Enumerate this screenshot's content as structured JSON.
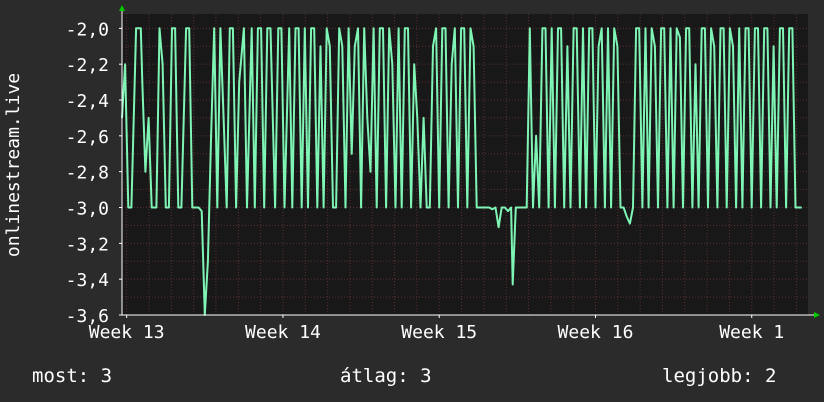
{
  "colors": {
    "background": "#2b2b2b",
    "plot_background": "#181818",
    "grid": "#5a3030",
    "line": "#7ff5b5",
    "axis_arrow": "#00cc00",
    "text": "#ffffff"
  },
  "chart_data": {
    "type": "line",
    "ylabel": "onlinestream.live",
    "y_ticks": [
      "-2,0",
      "-2,2",
      "-2,4",
      "-2,6",
      "-2,8",
      "-3,0",
      "-3,2",
      "-3,4",
      "-3,6"
    ],
    "y_tick_values": [
      -2.0,
      -2.2,
      -2.4,
      -2.6,
      -2.8,
      -3.0,
      -3.2,
      -3.4,
      -3.6
    ],
    "ylim": [
      -3.6,
      -1.92
    ],
    "x_ticks": [
      "Week 13",
      "Week 14",
      "Week 15",
      "Week 16",
      "Week 1"
    ],
    "x_tick_values": [
      13,
      14,
      15,
      16,
      17
    ],
    "xlim": [
      12.97,
      17.36
    ],
    "grid": true,
    "series": [
      {
        "color": "#7ff5b5",
        "points": [
          [
            12.97,
            -2.5
          ],
          [
            12.99,
            -2.2
          ],
          [
            13.01,
            -3.0
          ],
          [
            13.03,
            -3.0
          ],
          [
            13.06,
            -2.0
          ],
          [
            13.09,
            -2.0
          ],
          [
            13.1,
            -2.3
          ],
          [
            13.12,
            -2.8
          ],
          [
            13.14,
            -2.5
          ],
          [
            13.16,
            -3.0
          ],
          [
            13.19,
            -3.0
          ],
          [
            13.21,
            -2.0
          ],
          [
            13.23,
            -2.2
          ],
          [
            13.25,
            -3.0
          ],
          [
            13.27,
            -3.0
          ],
          [
            13.29,
            -2.0
          ],
          [
            13.31,
            -2.0
          ],
          [
            13.33,
            -3.0
          ],
          [
            13.35,
            -3.0
          ],
          [
            13.38,
            -2.0
          ],
          [
            13.4,
            -2.0
          ],
          [
            13.42,
            -3.0
          ],
          [
            13.46,
            -3.0
          ],
          [
            13.48,
            -3.02
          ],
          [
            13.5,
            -3.6
          ],
          [
            13.52,
            -3.3
          ],
          [
            13.54,
            -2.6
          ],
          [
            13.56,
            -2.0
          ],
          [
            13.58,
            -3.0
          ],
          [
            13.6,
            -2.0
          ],
          [
            13.62,
            -2.5
          ],
          [
            13.64,
            -3.0
          ],
          [
            13.66,
            -2.0
          ],
          [
            13.68,
            -2.0
          ],
          [
            13.7,
            -3.0
          ],
          [
            13.72,
            -2.3
          ],
          [
            13.75,
            -2.0
          ],
          [
            13.77,
            -3.0
          ],
          [
            13.8,
            -2.0
          ],
          [
            13.82,
            -3.0
          ],
          [
            13.84,
            -2.0
          ],
          [
            13.86,
            -2.0
          ],
          [
            13.88,
            -3.0
          ],
          [
            13.9,
            -2.0
          ],
          [
            13.92,
            -2.0
          ],
          [
            13.95,
            -3.0
          ],
          [
            13.97,
            -2.0
          ],
          [
            13.99,
            -2.0
          ],
          [
            14.01,
            -3.0
          ],
          [
            14.04,
            -2.0
          ],
          [
            14.06,
            -3.0
          ],
          [
            14.08,
            -2.0
          ],
          [
            14.1,
            -2.0
          ],
          [
            14.12,
            -3.0
          ],
          [
            14.14,
            -2.0
          ],
          [
            14.16,
            -3.0
          ],
          [
            14.18,
            -2.0
          ],
          [
            14.2,
            -2.0
          ],
          [
            14.22,
            -3.0
          ],
          [
            14.24,
            -2.1
          ],
          [
            14.26,
            -3.0
          ],
          [
            14.28,
            -2.0
          ],
          [
            14.3,
            -2.1
          ],
          [
            14.32,
            -3.0
          ],
          [
            14.34,
            -3.0
          ],
          [
            14.36,
            -2.0
          ],
          [
            14.38,
            -2.1
          ],
          [
            14.4,
            -3.0
          ],
          [
            14.42,
            -2.0
          ],
          [
            14.44,
            -2.7
          ],
          [
            14.46,
            -2.1
          ],
          [
            14.48,
            -2.0
          ],
          [
            14.5,
            -3.0
          ],
          [
            14.52,
            -2.0
          ],
          [
            14.54,
            -2.5
          ],
          [
            14.56,
            -2.8
          ],
          [
            14.58,
            -2.0
          ],
          [
            14.6,
            -3.0
          ],
          [
            14.62,
            -2.0
          ],
          [
            14.64,
            -2.0
          ],
          [
            14.66,
            -3.0
          ],
          [
            14.68,
            -2.0
          ],
          [
            14.7,
            -2.2
          ],
          [
            14.72,
            -3.0
          ],
          [
            14.74,
            -2.0
          ],
          [
            14.76,
            -3.0
          ],
          [
            14.78,
            -2.0
          ],
          [
            14.8,
            -2.0
          ],
          [
            14.82,
            -3.0
          ],
          [
            14.84,
            -2.2
          ],
          [
            14.86,
            -2.5
          ],
          [
            14.88,
            -3.0
          ],
          [
            14.9,
            -2.5
          ],
          [
            14.92,
            -3.0
          ],
          [
            14.94,
            -3.0
          ],
          [
            14.96,
            -2.1
          ],
          [
            14.98,
            -2.0
          ],
          [
            15.0,
            -3.0
          ],
          [
            15.02,
            -2.0
          ],
          [
            15.04,
            -2.0
          ],
          [
            15.06,
            -3.0
          ],
          [
            15.08,
            -2.2
          ],
          [
            15.1,
            -2.0
          ],
          [
            15.12,
            -3.0
          ],
          [
            15.14,
            -2.0
          ],
          [
            15.16,
            -2.0
          ],
          [
            15.18,
            -3.0
          ],
          [
            15.2,
            -2.0
          ],
          [
            15.22,
            -2.1
          ],
          [
            15.24,
            -3.0
          ],
          [
            15.26,
            -3.0
          ],
          [
            15.28,
            -3.0
          ],
          [
            15.3,
            -3.0
          ],
          [
            15.32,
            -3.0
          ],
          [
            15.34,
            -3.01
          ],
          [
            15.36,
            -3.0
          ],
          [
            15.38,
            -3.11
          ],
          [
            15.4,
            -3.0
          ],
          [
            15.42,
            -3.0
          ],
          [
            15.44,
            -3.02
          ],
          [
            15.46,
            -3.0
          ],
          [
            15.47,
            -3.43
          ],
          [
            15.49,
            -3.0
          ],
          [
            15.51,
            -3.0
          ],
          [
            15.53,
            -3.0
          ],
          [
            15.56,
            -3.0
          ],
          [
            15.58,
            -2.0
          ],
          [
            15.6,
            -3.0
          ],
          [
            15.62,
            -2.6
          ],
          [
            15.64,
            -3.0
          ],
          [
            15.66,
            -2.0
          ],
          [
            15.68,
            -2.0
          ],
          [
            15.7,
            -3.0
          ],
          [
            15.72,
            -2.0
          ],
          [
            15.74,
            -3.0
          ],
          [
            15.76,
            -2.0
          ],
          [
            15.78,
            -2.0
          ],
          [
            15.8,
            -3.0
          ],
          [
            15.82,
            -2.1
          ],
          [
            15.84,
            -3.0
          ],
          [
            15.86,
            -2.0
          ],
          [
            15.88,
            -2.0
          ],
          [
            15.9,
            -3.0
          ],
          [
            15.92,
            -2.0
          ],
          [
            15.94,
            -3.0
          ],
          [
            15.96,
            -2.0
          ],
          [
            15.98,
            -2.0
          ],
          [
            16.0,
            -3.0
          ],
          [
            16.02,
            -2.1
          ],
          [
            16.04,
            -2.0
          ],
          [
            16.06,
            -3.0
          ],
          [
            16.08,
            -2.0
          ],
          [
            16.1,
            -3.0
          ],
          [
            16.12,
            -2.0
          ],
          [
            16.14,
            -2.1
          ],
          [
            16.16,
            -3.0
          ],
          [
            16.18,
            -3.0
          ],
          [
            16.2,
            -3.05
          ],
          [
            16.22,
            -3.09
          ],
          [
            16.24,
            -3.0
          ],
          [
            16.26,
            -2.0
          ],
          [
            16.28,
            -2.0
          ],
          [
            16.3,
            -3.0
          ],
          [
            16.32,
            -2.0
          ],
          [
            16.34,
            -3.0
          ],
          [
            16.36,
            -2.0
          ],
          [
            16.38,
            -2.1
          ],
          [
            16.4,
            -3.0
          ],
          [
            16.42,
            -2.0
          ],
          [
            16.44,
            -2.0
          ],
          [
            16.46,
            -3.0
          ],
          [
            16.48,
            -2.0
          ],
          [
            16.5,
            -3.0
          ],
          [
            16.52,
            -2.0
          ],
          [
            16.54,
            -2.05
          ],
          [
            16.56,
            -3.0
          ],
          [
            16.58,
            -2.0
          ],
          [
            16.6,
            -2.0
          ],
          [
            16.62,
            -3.0
          ],
          [
            16.64,
            -2.2
          ],
          [
            16.66,
            -3.0
          ],
          [
            16.68,
            -2.0
          ],
          [
            16.7,
            -2.0
          ],
          [
            16.72,
            -3.0
          ],
          [
            16.74,
            -2.0
          ],
          [
            16.76,
            -2.1
          ],
          [
            16.78,
            -3.0
          ],
          [
            16.8,
            -2.0
          ],
          [
            16.82,
            -2.0
          ],
          [
            16.84,
            -3.0
          ],
          [
            16.86,
            -2.0
          ],
          [
            16.88,
            -2.1
          ],
          [
            16.9,
            -3.0
          ],
          [
            16.92,
            -2.0
          ],
          [
            16.94,
            -3.0
          ],
          [
            16.96,
            -2.0
          ],
          [
            16.98,
            -2.0
          ],
          [
            17.0,
            -3.0
          ],
          [
            17.02,
            -2.0
          ],
          [
            17.04,
            -2.0
          ],
          [
            17.06,
            -3.0
          ],
          [
            17.08,
            -2.0
          ],
          [
            17.1,
            -2.0
          ],
          [
            17.12,
            -3.0
          ],
          [
            17.14,
            -2.1
          ],
          [
            17.16,
            -3.0
          ],
          [
            17.18,
            -2.0
          ],
          [
            17.2,
            -2.0
          ],
          [
            17.22,
            -3.0
          ],
          [
            17.24,
            -2.0
          ],
          [
            17.26,
            -2.0
          ],
          [
            17.28,
            -3.0
          ],
          [
            17.3,
            -3.0
          ],
          [
            17.32,
            -3.0
          ]
        ]
      }
    ]
  },
  "footer": {
    "current": "most: 3",
    "average": "átlag: 3",
    "best": "legjobb: 2"
  }
}
